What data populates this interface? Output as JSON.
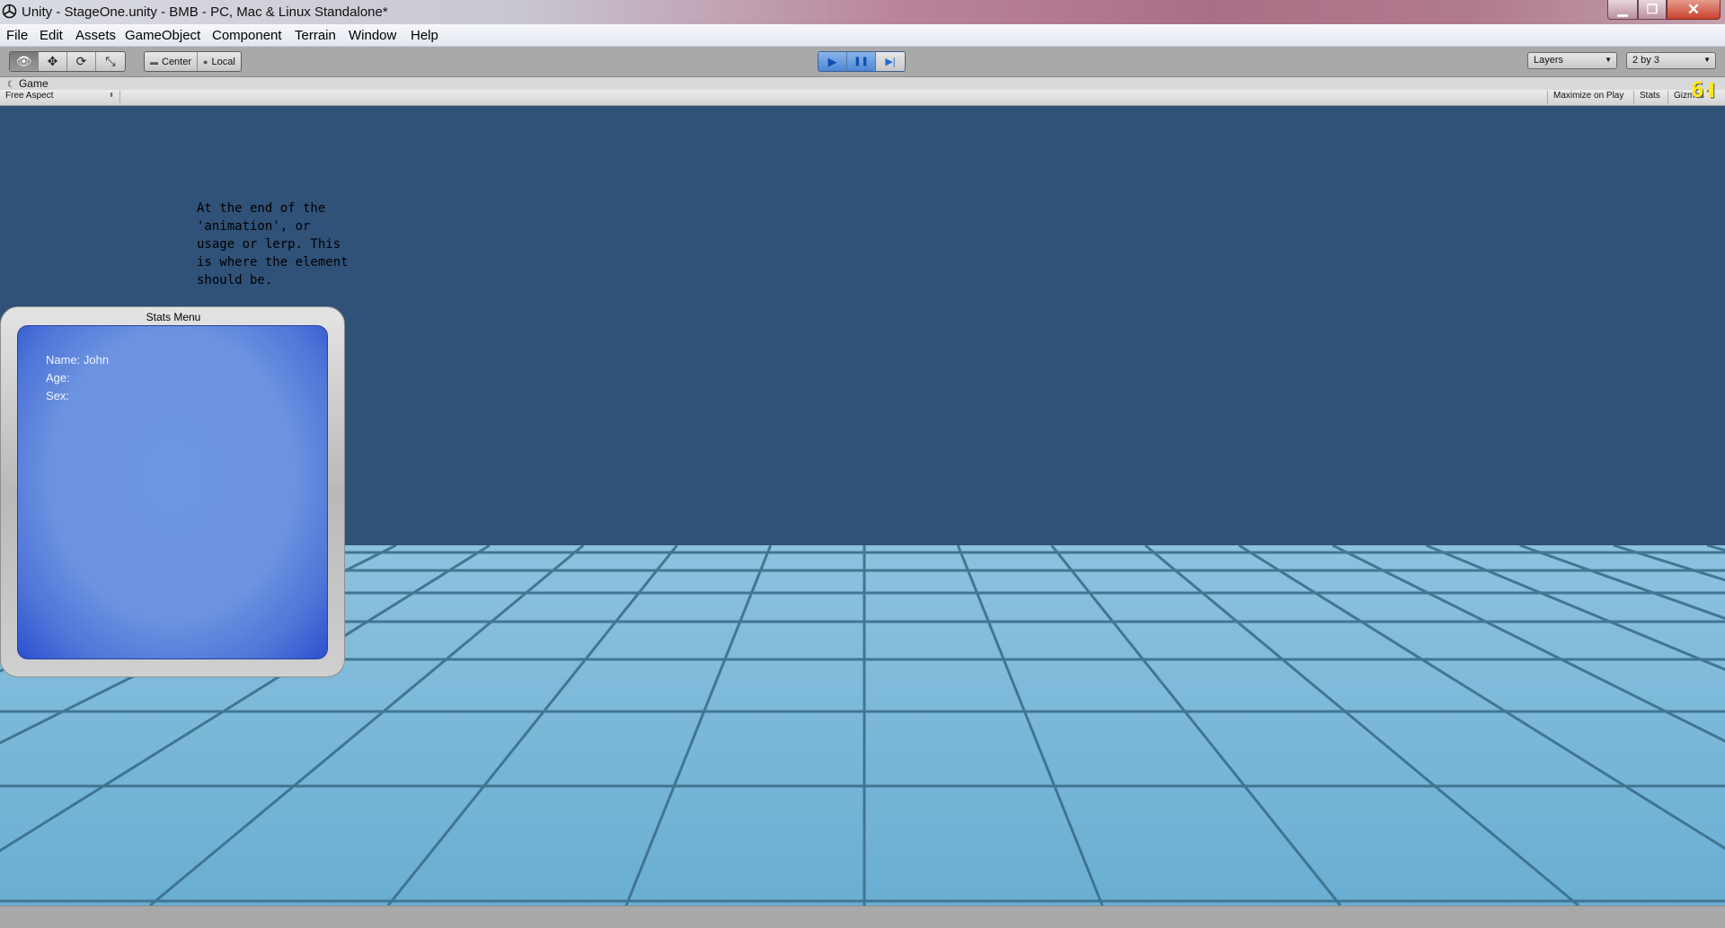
{
  "window": {
    "title": "Unity - StageOne.unity - BMB - PC, Mac & Linux Standalone*",
    "minimize_glyph": "▁",
    "maximize_glyph": "❐",
    "close_glyph": "✕"
  },
  "menu": {
    "items": [
      {
        "label": "File",
        "key": "F"
      },
      {
        "label": "Edit",
        "key": "E"
      },
      {
        "label": "Assets",
        "key": ""
      },
      {
        "label": "GameObject",
        "key": ""
      },
      {
        "label": "Component",
        "key": ""
      },
      {
        "label": "Terrain",
        "key": ""
      },
      {
        "label": "Window",
        "key": "W"
      },
      {
        "label": "Help",
        "key": "H"
      }
    ]
  },
  "toolbar": {
    "transform_tools": [
      {
        "name": "hand-tool",
        "glyph": "👁"
      },
      {
        "name": "move-tool",
        "glyph": "✥"
      },
      {
        "name": "rotate-tool",
        "glyph": "⟳"
      },
      {
        "name": "scale-tool",
        "glyph": "⤡"
      }
    ],
    "pivot_label": "Center",
    "space_label": "Local",
    "play_glyph": "▶",
    "pause_glyph": "❚❚",
    "step_glyph": "▶|",
    "layers_label": "Layers",
    "layout_label": "2 by 3"
  },
  "game_panel": {
    "tab_label": "Game",
    "aspect_label": "Free Aspect",
    "maximize_label": "Maximize on Play",
    "stats_label": "Stats",
    "gizmos_label": "Gizmos",
    "fps_overlay": "6"
  },
  "scene": {
    "note": "At the end of the\n'animation', or\nusage or lerp. This\nis where the element\nshould be.",
    "stats_window": {
      "title": "Stats Menu",
      "name_line": "Name: John",
      "age_line": "Age:",
      "sex_line": "Sex:"
    }
  },
  "colors": {
    "sky": "#305178",
    "floor_light": "#7ab7d9",
    "floor_dark": "#5f9fc4",
    "grid_line": "#3a6f89",
    "panel_blue": "#6d93e0",
    "fps_yellow": "#ffe81a"
  }
}
